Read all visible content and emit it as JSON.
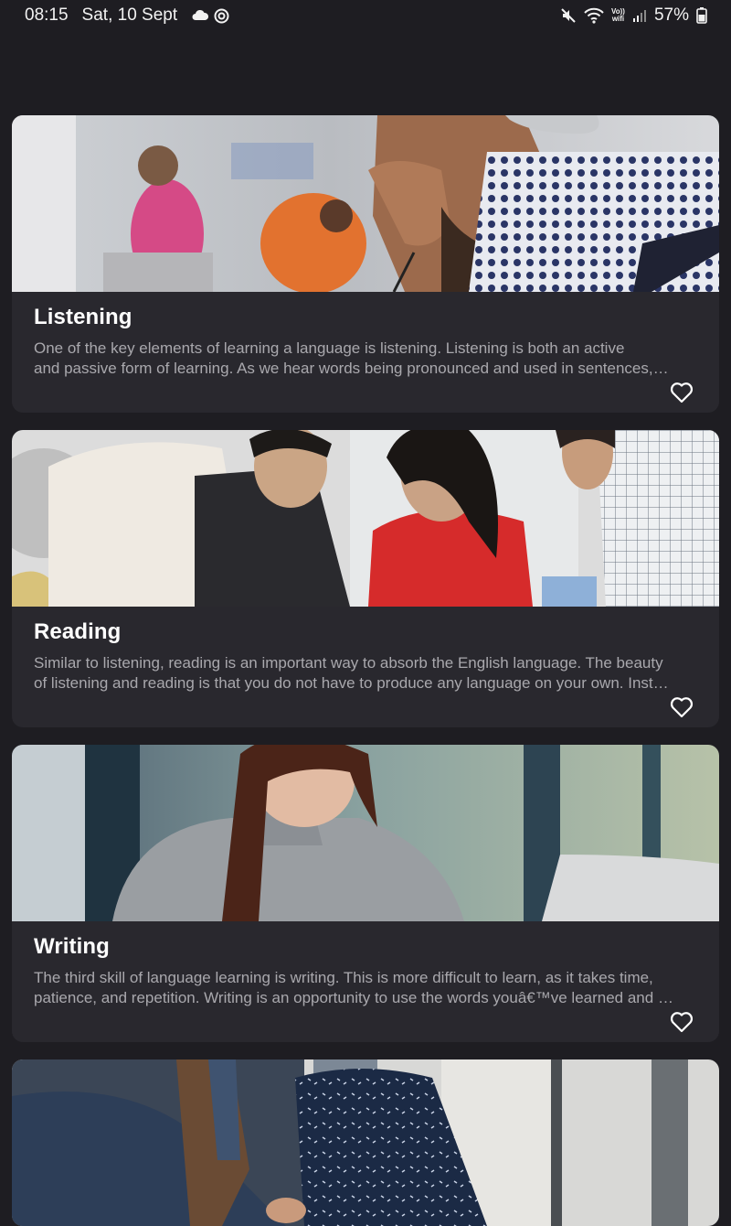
{
  "status_bar": {
    "time": "08:15",
    "date": "Sat, 10 Sept",
    "vowifi_line1": "Vo))",
    "vowifi_line2": "wifi",
    "battery": "57%",
    "icons": [
      "cloud-icon",
      "sync-icon",
      "mute-icon",
      "wifi-icon",
      "signal-icon",
      "battery-icon"
    ]
  },
  "cards": [
    {
      "title": "Listening",
      "desc_line1": "One of the key elements of learning a language is listening. Listening is both an active",
      "desc_line2": "and passive form of learning. As we hear words being pronounced and used in sentences,…",
      "image": "man-with-headphones-photo",
      "favorite": false
    },
    {
      "title": "Reading",
      "desc_line1": "Similar to listening, reading is an important way to absorb the English language. The beauty",
      "desc_line2": "of listening and reading is that you do not have to produce any language on your own. Inst…",
      "image": "group-reading-photo",
      "favorite": false
    },
    {
      "title": "Writing",
      "desc_line1": "The third skill of language learning is writing. This is more difficult to learn, as it takes time,",
      "desc_line2": "patience, and repetition. Writing is an opportunity to use the words youâ€™ve learned and …",
      "image": "woman-writing-photo",
      "favorite": false
    },
    {
      "title": "",
      "image": "handshake-photo"
    }
  ],
  "colors": {
    "background": "#1e1d22",
    "card": "#29282e",
    "title": "#ffffff",
    "description": "#a9a8ad"
  }
}
